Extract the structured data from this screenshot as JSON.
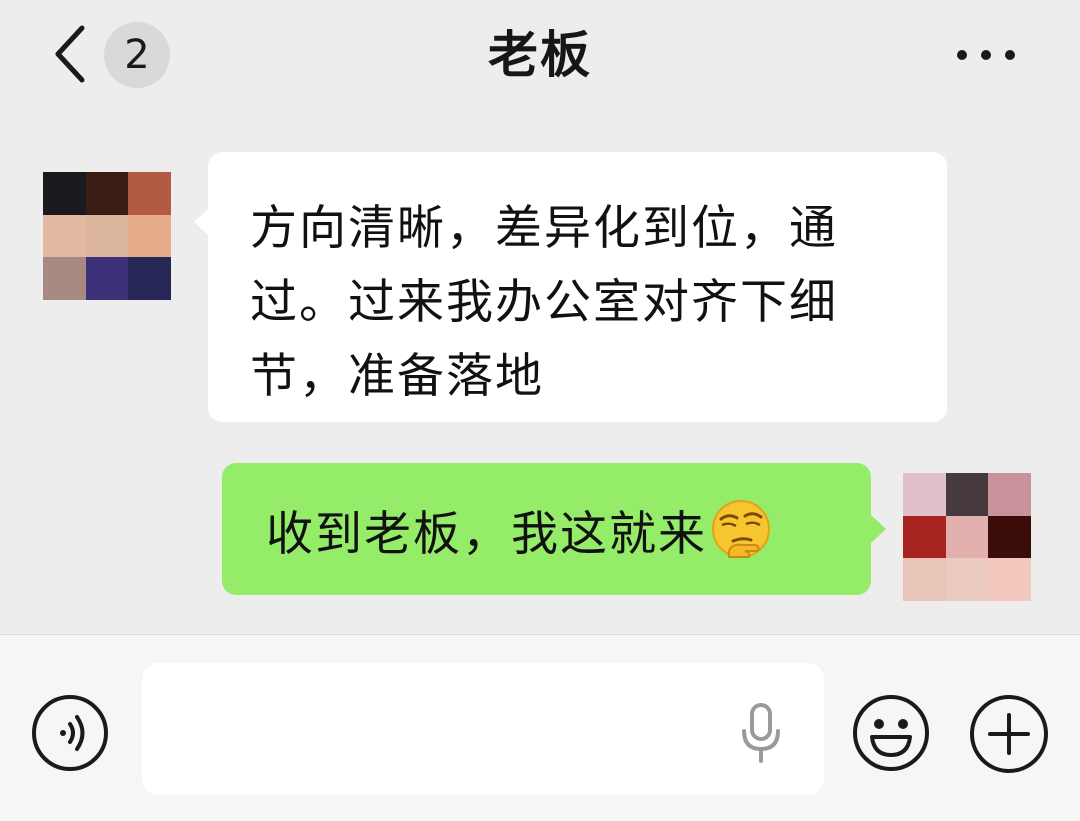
{
  "header": {
    "title": "老板",
    "unread_count": "2",
    "back_icon": "chevron-left-icon",
    "more_icon": "more-horizontal-icon"
  },
  "messages": [
    {
      "direction": "incoming",
      "text": "方向清晰，差异化到位，通\n过。过来我办公室对齐下细\n节，准备落地"
    },
    {
      "direction": "outgoing",
      "text": "收到老板，我这就来",
      "emoji": "smirk-emoji"
    }
  ],
  "colors": {
    "background": "#ededed",
    "incoming_bubble": "#ffffff",
    "outgoing_bubble": "#95ec69",
    "input_bar": "#f6f6f6"
  },
  "input_bar": {
    "value": "",
    "voice_icon": "voice-icon",
    "mic_icon": "microphone-icon",
    "emoji_icon": "emoji-icon",
    "plus_icon": "plus-icon"
  }
}
